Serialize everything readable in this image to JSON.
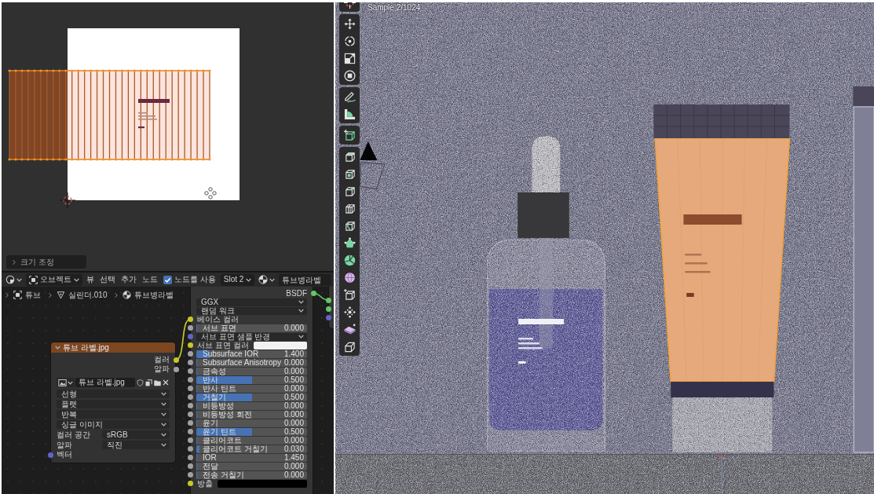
{
  "uv_editor": {
    "operator_panel": {
      "label": "크기 조정",
      "expanded": false
    }
  },
  "node_editor": {
    "header": {
      "object_mode": "오브젝트",
      "menus": [
        "뷰",
        "선택",
        "추가",
        "노드"
      ],
      "use_nodes": {
        "label": "노드를 사용",
        "checked": true
      },
      "slot": "Slot 2",
      "material": "튜브병라벨"
    },
    "breadcrumbs": [
      {
        "kind": "object",
        "label": "튜브"
      },
      {
        "kind": "mesh",
        "label": "실린더.010"
      },
      {
        "kind": "material",
        "label": "튜브병라벨"
      }
    ],
    "image_node": {
      "title": "튜브 라벨.jpg",
      "outputs": [
        {
          "label": "컬러",
          "socket": {
            "color": "#c7c729",
            "linked": true
          }
        },
        {
          "label": "알파",
          "socket": {
            "color": "#a1a1a1"
          }
        }
      ],
      "image": "튜브 라벨.jpg",
      "options": [
        "선형",
        "플랫",
        "반복",
        "싱글 이미지"
      ],
      "settings": [
        {
          "label": "컬러 공간",
          "value": "sRGB"
        },
        {
          "label": "알파",
          "value": "직진"
        }
      ],
      "inputs": [
        {
          "label": "벡터",
          "socket": {
            "color": "#6363c7"
          }
        }
      ]
    },
    "bsdf_node": {
      "output": {
        "label": "BSDF",
        "socket": {
          "color": "#63c763",
          "linked": true
        }
      },
      "rows": [
        {
          "kind": "dropdown",
          "value": "GGX"
        },
        {
          "kind": "dropdown",
          "value": "랜덤 워크"
        },
        {
          "kind": "label",
          "label": "베이스 컬러",
          "socket": {
            "color": "#c7c729",
            "linked": true
          }
        },
        {
          "kind": "slider",
          "label": "서브 표면",
          "value": "0.000",
          "level": 0,
          "socket": {
            "color": "#a1a1a1",
            "linked": false
          }
        },
        {
          "kind": "vector",
          "label": "서브 표면 샘플 반경",
          "socket": {
            "color": "#6363c7",
            "linked": false
          }
        },
        {
          "kind": "color",
          "label": "서브 표면 컬러",
          "color": "#f2f2f2",
          "socket": {
            "color": "#c7c729",
            "linked": false
          }
        },
        {
          "kind": "slider",
          "label": "Subsurface IOR",
          "value": "1.400",
          "level": 0.12,
          "socket": {
            "color": "#a1a1a1",
            "linked": false
          }
        },
        {
          "kind": "slider",
          "label": "Subsurface Anisotropy",
          "value": "0.000",
          "level": 0,
          "socket": {
            "color": "#a1a1a1",
            "linked": false
          }
        },
        {
          "kind": "slider",
          "label": "금속성",
          "value": "0.000",
          "level": 0,
          "socket": {
            "color": "#a1a1a1",
            "linked": false
          }
        },
        {
          "kind": "slider",
          "label": "반사",
          "value": "0.500",
          "level": 0.5,
          "socket": {
            "color": "#a1a1a1",
            "linked": false
          }
        },
        {
          "kind": "slider",
          "label": "반사 틴트",
          "value": "0.000",
          "level": 0,
          "socket": {
            "color": "#a1a1a1",
            "linked": false
          }
        },
        {
          "kind": "slider",
          "label": "거칠기",
          "value": "0.500",
          "level": 0.5,
          "socket": {
            "color": "#a1a1a1",
            "linked": false
          }
        },
        {
          "kind": "slider",
          "label": "비등방성",
          "value": "0.000",
          "level": 0,
          "socket": {
            "color": "#a1a1a1",
            "linked": false
          }
        },
        {
          "kind": "slider",
          "label": "비등방성 회전",
          "value": "0.000",
          "level": 0,
          "socket": {
            "color": "#a1a1a1",
            "linked": false
          }
        },
        {
          "kind": "slider",
          "label": "윤기",
          "value": "0.000",
          "level": 0,
          "socket": {
            "color": "#a1a1a1",
            "linked": false
          }
        },
        {
          "kind": "slider",
          "label": "윤기 틴트",
          "value": "0.500",
          "level": 0.5,
          "socket": {
            "color": "#a1a1a1",
            "linked": false
          }
        },
        {
          "kind": "slider",
          "label": "클리어코트",
          "value": "0.000",
          "level": 0,
          "socket": {
            "color": "#a1a1a1",
            "linked": false
          }
        },
        {
          "kind": "slider",
          "label": "클리어코트 거칠기",
          "value": "0.030",
          "level": 0.03,
          "socket": {
            "color": "#a1a1a1",
            "linked": false
          }
        },
        {
          "kind": "slider",
          "label": "IOR",
          "value": "1.450",
          "level": 0,
          "socket": {
            "color": "#a1a1a1",
            "linked": false
          }
        },
        {
          "kind": "slider",
          "label": "전달",
          "value": "0.000",
          "level": 0,
          "socket": {
            "color": "#a1a1a1",
            "linked": false
          }
        },
        {
          "kind": "slider",
          "label": "전송 거칠기",
          "value": "0.000",
          "level": 0,
          "socket": {
            "color": "#a1a1a1",
            "linked": false
          }
        },
        {
          "kind": "color",
          "label": "방출",
          "color": "#000000",
          "socket": {
            "color": "#c7c729",
            "linked": false
          }
        }
      ]
    }
  },
  "viewport": {
    "overlay_text": "Sample 2/1024"
  }
}
